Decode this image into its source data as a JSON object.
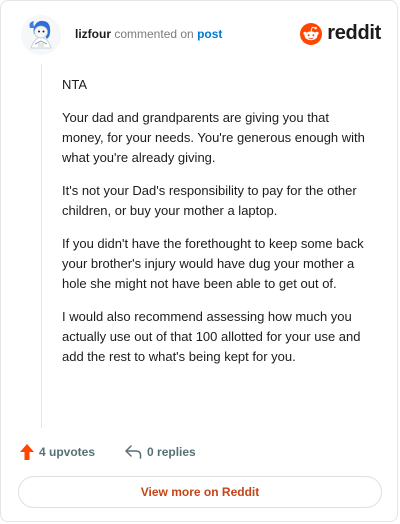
{
  "comment": {
    "username": "lizfour",
    "action_text": "commented on",
    "target_link": "post",
    "paragraphs": [
      "NTA",
      "Your dad and grandparents are giving you that money, for your needs. You're generous enough with what you're already giving.",
      "It's not your Dad's responsibility to pay for the other children, or buy your mother a laptop.",
      "If you didn't have the forethought to keep some back your brother's injury would have dug your mother a hole she might not have been able to get out of.",
      "I would also recommend assessing how much you actually use out of that 100 allotted for your use and add the rest to what's being kept for you."
    ]
  },
  "brand": {
    "name": "reddit",
    "icon": "reddit-logo-icon",
    "color": "#ff4500"
  },
  "actions": {
    "upvotes_label": "4 upvotes",
    "upvote_icon": "upvote-arrow-icon",
    "replies_label": "0 replies",
    "reply_icon": "reply-icon"
  },
  "footer": {
    "view_more_label": "View more on Reddit"
  },
  "colors": {
    "upvote": "#ff4500",
    "link": "#0079d3",
    "view_more_text": "#c34418"
  }
}
